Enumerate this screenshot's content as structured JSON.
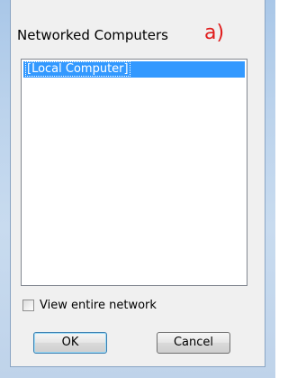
{
  "dialog": {
    "title": "Networked Computers",
    "annotation": "a)"
  },
  "computer_list": {
    "items": [
      {
        "label": "[Local Computer]",
        "selected": true
      }
    ]
  },
  "view_entire_network": {
    "label": "View entire network",
    "checked": false
  },
  "buttons": {
    "ok_label": "OK",
    "cancel_label": "Cancel"
  },
  "colors": {
    "selection": "#3399ff",
    "annotation": "#e01c1c",
    "frame": "#bcd3ec"
  }
}
